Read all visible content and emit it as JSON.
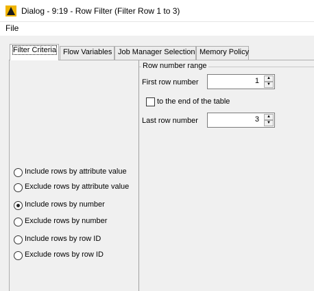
{
  "window": {
    "title": "Dialog - 9:19 - Row Filter (Filter Row 1 to 3)"
  },
  "menu": {
    "file": "File"
  },
  "tabs": [
    {
      "label": "Filter Criteria",
      "active": true
    },
    {
      "label": "Flow Variables",
      "active": false
    },
    {
      "label": "Job Manager Selection",
      "active": false
    },
    {
      "label": "Memory Policy",
      "active": false
    }
  ],
  "filter_options": [
    {
      "label": "Include rows by attribute value",
      "checked": false
    },
    {
      "label": "Exclude rows by attribute value",
      "checked": false
    },
    {
      "label": "Include rows by number",
      "checked": true
    },
    {
      "label": "Exclude rows by number",
      "checked": false
    },
    {
      "label": "Include rows by row ID",
      "checked": false
    },
    {
      "label": "Exclude rows by row ID",
      "checked": false
    }
  ],
  "row_range": {
    "title": "Row number range",
    "first_label": "First row number",
    "first_value": "1",
    "to_end_label": "to the end of the table",
    "to_end_checked": false,
    "last_label": "Last row number",
    "last_value": "3"
  },
  "colors": {
    "app_icon": "#f0b400",
    "background": "#f0f0f0"
  }
}
